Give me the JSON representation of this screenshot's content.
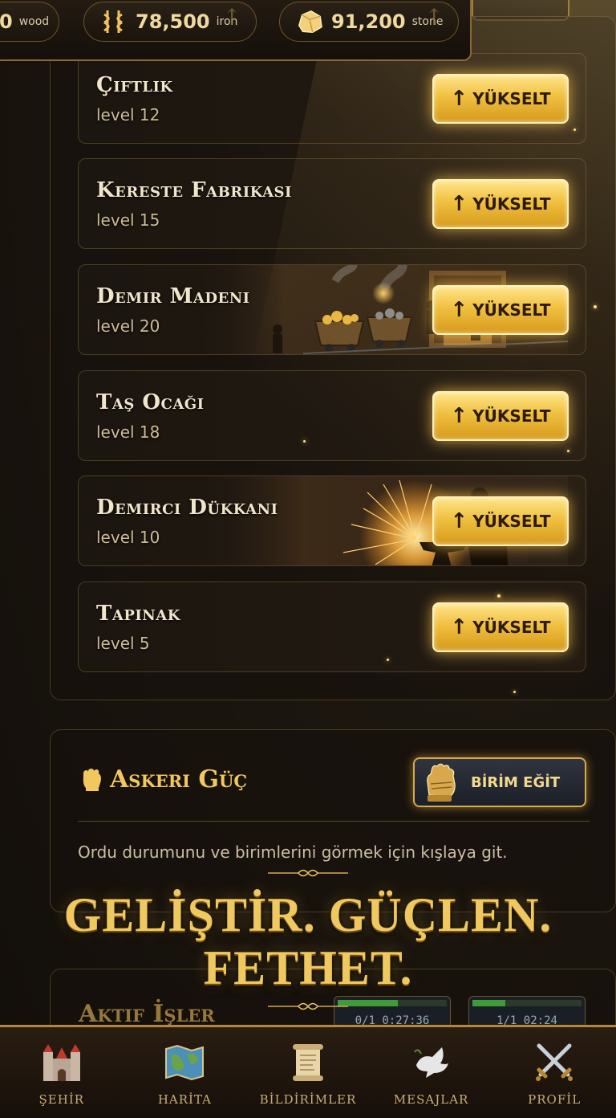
{
  "resources": [
    {
      "icon": "wood-icon",
      "value": "",
      "unit": "wood"
    },
    {
      "icon": "iron-icon",
      "value": "78,500",
      "unit": "iron"
    },
    {
      "icon": "stone-icon",
      "value": "91,200",
      "unit": "stone"
    }
  ],
  "buildings": [
    {
      "name": "Çiftlik",
      "level": "level 12",
      "button": "YÜKSELT"
    },
    {
      "name": "Kereste Fabrikası",
      "level": "level 15",
      "button": "YÜKSELT"
    },
    {
      "name": "Demir Madeni",
      "level": "level 20",
      "button": "YÜKSELT",
      "art": "mine-scene"
    },
    {
      "name": "Taş Ocağı",
      "level": "level 18",
      "button": "YÜKSELT"
    },
    {
      "name": "Demirci Dükkanı",
      "level": "level 10",
      "button": "YÜKSELT",
      "art": "blacksmith-scene"
    },
    {
      "name": "Tapınak",
      "level": "level 5",
      "button": "YÜKSELT"
    }
  ],
  "military": {
    "title": "Askeri Güç",
    "train_button": "BİRİM EĞİT",
    "description": "Ordu durumunu ve birimlerini görmek için kışlaya git."
  },
  "tagline": {
    "line1": "GELİŞTİR. GÜÇLEN.",
    "line2": "FETHET."
  },
  "active_jobs": {
    "title": "Aktif İşler",
    "jobs": [
      {
        "time": "0/1 0:27:36",
        "progress": 0.55
      },
      {
        "time": "1/1 02:24",
        "progress": 0.3
      }
    ]
  },
  "nav": [
    {
      "label": "ŞEHİR",
      "icon": "castle-icon"
    },
    {
      "label": "HARİTA",
      "icon": "map-icon"
    },
    {
      "label": "BİLDİRİMLER",
      "icon": "scroll-icon"
    },
    {
      "label": "MESAJLAR",
      "icon": "dove-icon"
    },
    {
      "label": "PROFİL",
      "icon": "crossed-swords-icon"
    }
  ],
  "colors": {
    "gold": "#f0c040",
    "accent": "#b8872f",
    "background": "#120e0a"
  }
}
